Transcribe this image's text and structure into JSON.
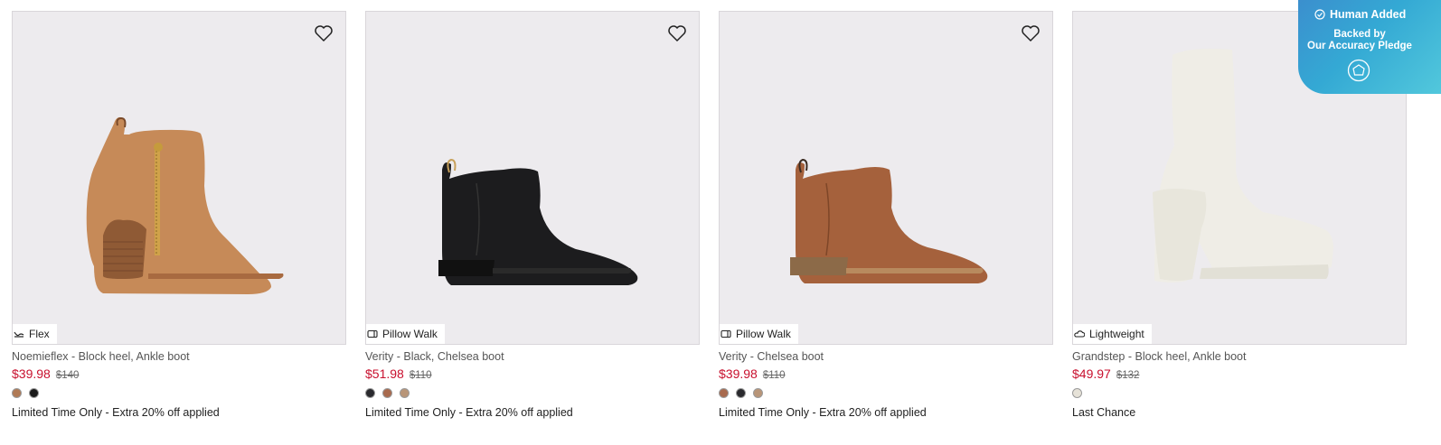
{
  "products": [
    {
      "name": "Noemieflex - Block heel, Ankle boot",
      "feature": "Flex",
      "feature_icon": "flex-icon",
      "sale_price": "$39.98",
      "original_price": "$140",
      "swatches": [
        "#b07a55",
        "#1a1a1a"
      ],
      "promo": "Limited Time Only - Extra 20% off applied"
    },
    {
      "name": "Verity - Black, Chelsea boot",
      "feature": "Pillow Walk",
      "feature_icon": "pillow-walk-icon",
      "sale_price": "$51.98",
      "original_price": "$110",
      "swatches": [
        "#2a2a2e",
        "#a86a4e",
        "#b89578"
      ],
      "promo": "Limited Time Only - Extra 20% off applied"
    },
    {
      "name": "Verity - Chelsea boot",
      "feature": "Pillow Walk",
      "feature_icon": "pillow-walk-icon",
      "sale_price": "$39.98",
      "original_price": "$110",
      "swatches": [
        "#a86a4e",
        "#2a2a2e",
        "#b89578"
      ],
      "promo": "Limited Time Only - Extra 20% off applied"
    },
    {
      "name": "Grandstep - Block heel, Ankle boot",
      "feature": "Lightweight",
      "feature_icon": "lightweight-icon",
      "sale_price": "$49.97",
      "original_price": "$132",
      "swatches": [
        "#e6e2d8"
      ],
      "promo": "Last Chance"
    }
  ],
  "badge": {
    "title": "Human Added",
    "line1": "Backed by",
    "line2": "Our Accuracy Pledge",
    "icon": "shield-icon"
  },
  "colors": {
    "sale": "#c8102e",
    "image_bg": "#edebee",
    "badge_start": "#3b8fce",
    "badge_end": "#52c8dc"
  }
}
